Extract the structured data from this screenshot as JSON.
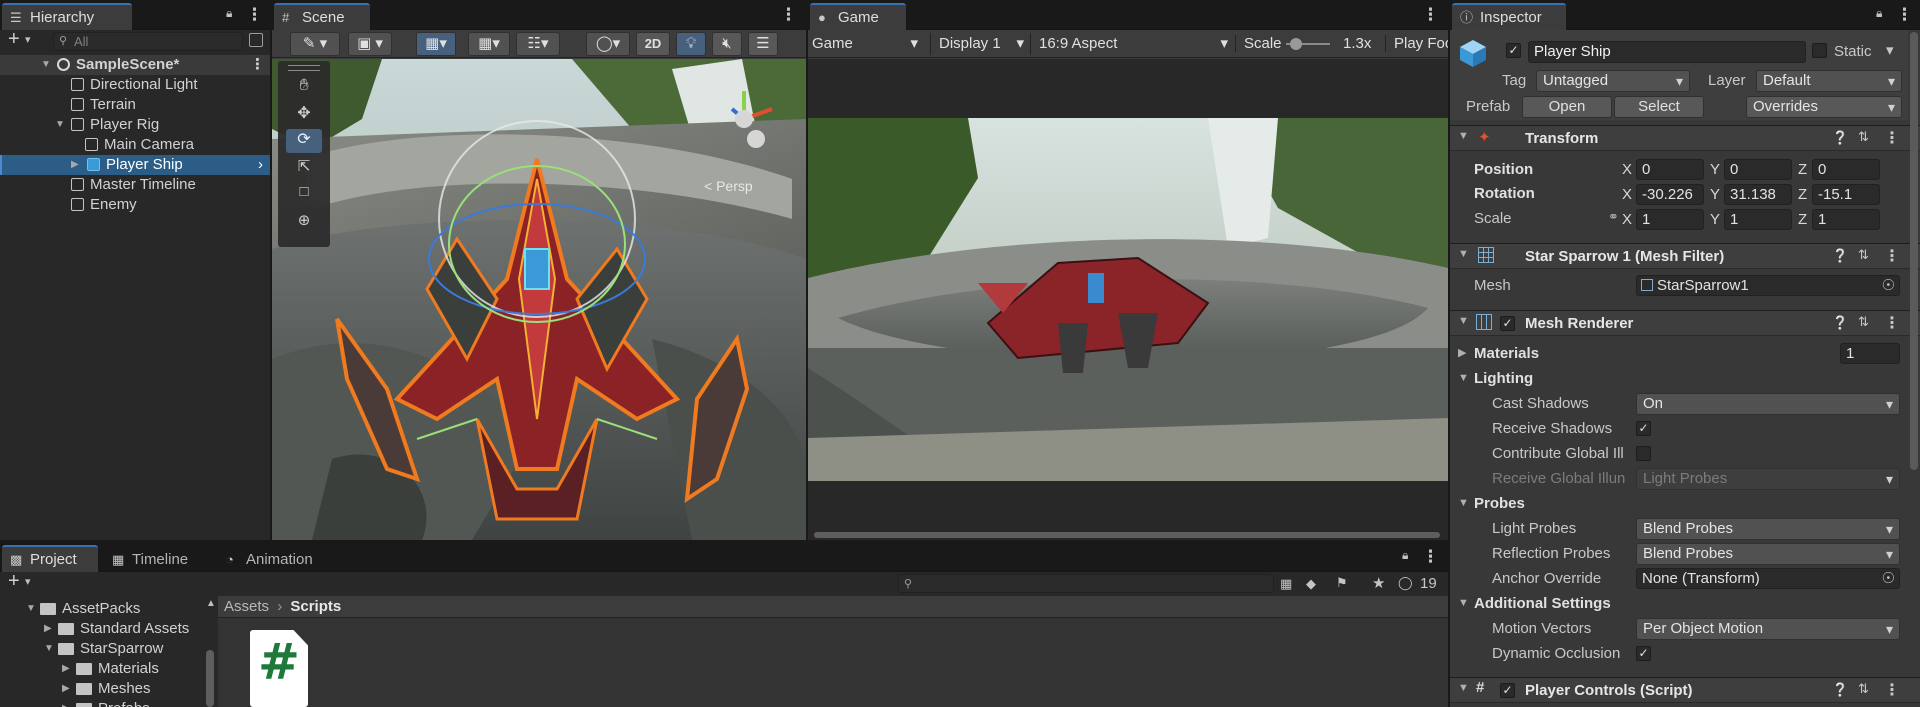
{
  "hierarchy": {
    "tab": "Hierarchy",
    "search_placeholder": "All",
    "items": [
      {
        "label": "SampleScene*",
        "depth": 0,
        "expanded": true,
        "scene": true
      },
      {
        "label": "Directional Light",
        "depth": 1
      },
      {
        "label": "Terrain",
        "depth": 1
      },
      {
        "label": "Player Rig",
        "depth": 1,
        "expanded": true
      },
      {
        "label": "Main Camera",
        "depth": 2
      },
      {
        "label": "Player Ship",
        "depth": 2,
        "selected": true,
        "collapsed": true
      },
      {
        "label": "Master Timeline",
        "depth": 1
      },
      {
        "label": "Enemy",
        "depth": 1
      }
    ]
  },
  "scene": {
    "tab": "Scene",
    "mode_2d": "2D",
    "persp_label": "< Persp"
  },
  "game": {
    "tab": "Game",
    "display_mode": "Game",
    "display": "Display 1",
    "aspect": "16:9 Aspect",
    "scale_label": "Scale",
    "scale_value": "1.3x",
    "play_focus": "Play Foc"
  },
  "inspector": {
    "tab": "Inspector",
    "object_name": "Player Ship",
    "static_label": "Static",
    "tag_label": "Tag",
    "tag_value": "Untagged",
    "layer_label": "Layer",
    "layer_value": "Default",
    "prefab_label": "Prefab",
    "open": "Open",
    "select": "Select",
    "overrides": "Overrides",
    "transform": {
      "title": "Transform",
      "position_label": "Position",
      "rotation_label": "Rotation",
      "scale_label": "Scale",
      "position": [
        "0",
        "0",
        "0"
      ],
      "rotation": [
        "-30.226",
        "31.138",
        "-15.1"
      ],
      "scale": [
        "1",
        "1",
        "1"
      ],
      "axes": [
        "X",
        "Y",
        "Z"
      ]
    },
    "mesh_filter": {
      "title": "Star Sparrow 1 (Mesh Filter)",
      "mesh_label": "Mesh",
      "mesh_value": "StarSparrow1"
    },
    "mesh_renderer": {
      "title": "Mesh Renderer",
      "materials_label": "Materials",
      "materials_count": "1",
      "lighting": "Lighting",
      "cast_shadows_label": "Cast Shadows",
      "cast_shadows": "On",
      "receive_shadows_label": "Receive Shadows",
      "contribute_gi_label": "Contribute Global Ill",
      "receive_gi_label": "Receive Global Illun",
      "receive_gi_value": "Light Probes",
      "probes": "Probes",
      "light_probes_label": "Light Probes",
      "light_probes": "Blend Probes",
      "reflection_probes_label": "Reflection Probes",
      "reflection_probes": "Blend Probes",
      "anchor_label": "Anchor Override",
      "anchor_value": "None (Transform)",
      "additional": "Additional Settings",
      "motion_vectors_label": "Motion Vectors",
      "motion_vectors": "Per Object Motion",
      "dynamic_occlusion_label": "Dynamic Occlusion"
    },
    "player_controls": {
      "title": "Player Controls (Script)"
    }
  },
  "project": {
    "tabs": [
      "Project",
      "Timeline",
      "Animation"
    ],
    "hidden_count": "19",
    "tree": [
      {
        "label": "AssetPacks",
        "depth": 0,
        "expanded": true
      },
      {
        "label": "Standard Assets",
        "depth": 1
      },
      {
        "label": "StarSparrow",
        "depth": 1,
        "expanded": true
      },
      {
        "label": "Materials",
        "depth": 2
      },
      {
        "label": "Meshes",
        "depth": 2
      },
      {
        "label": "Prefabs",
        "depth": 2
      }
    ],
    "breadcrumb": [
      "Assets",
      "Scripts"
    ],
    "script_glyph": "#"
  },
  "colors": {
    "accent": "#3a72b0",
    "selection": "#2c5d87",
    "panel": "#282828",
    "header": "#3c3c3c"
  }
}
